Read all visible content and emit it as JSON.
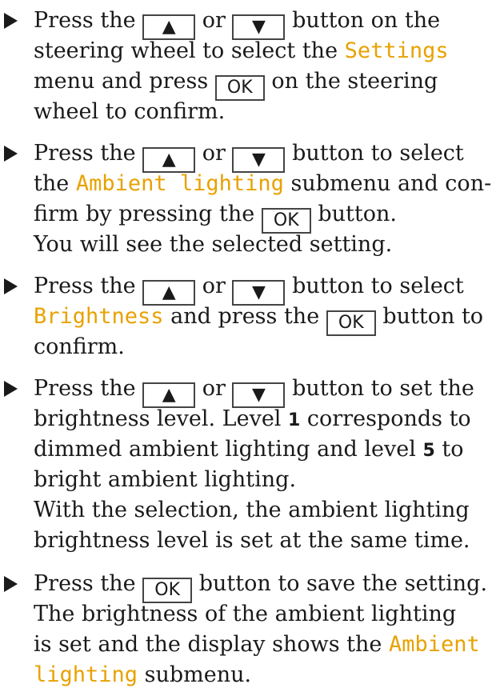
{
  "buttons": {
    "up": "▲",
    "down": "▼",
    "ok": "OK"
  },
  "step1": {
    "l1a": "Press the ",
    "l1b": " or ",
    "l1c": " button on the",
    "l2a": "steering wheel to select the ",
    "l2hl": "Settings",
    "l3a": "menu and press ",
    "l3b": " on the steering",
    "l4": "wheel to confirm."
  },
  "step2": {
    "l1a": "Press the ",
    "l1b": " or ",
    "l1c": " button to select",
    "l2a": "the ",
    "l2hl": "Ambient lighting",
    "l2b": " submenu and con-",
    "l3a": "firm by pressing the ",
    "l3b": " button.",
    "l4": "You will see the selected setting."
  },
  "step3": {
    "l1a": "Press the ",
    "l1b": " or ",
    "l1c": " button to select",
    "l2hl": "Brightness",
    "l2a": " and press the ",
    "l2b": " button to",
    "l3": "confirm."
  },
  "step4": {
    "l1a": "Press the ",
    "l1b": " or ",
    "l1c": " button to set the",
    "l2a": "brightness level. Level ",
    "l2num": "1",
    "l2b": " corresponds to",
    "l3a": "dimmed ambient lighting and level ",
    "l3num": "5",
    "l3b": " to",
    "l4": "bright ambient lighting.",
    "l5": "With the selection, the ambient lighting",
    "l6": "brightness level is set at the same time."
  },
  "step5": {
    "l1a": "Press the ",
    "l1b": " button to save the setting.",
    "l2": "The brightness of the ambient lighting",
    "l3a": "is set and the display shows the ",
    "l3hl": "Ambient",
    "l4hl": "lighting",
    "l4a": " submenu."
  }
}
